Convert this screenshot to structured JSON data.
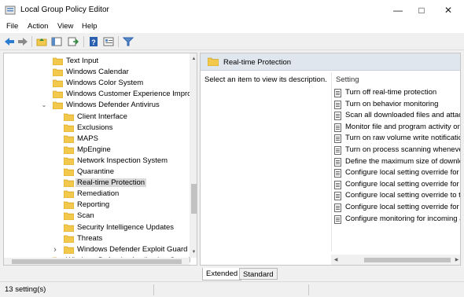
{
  "window": {
    "title": "Local Group Policy Editor"
  },
  "menu": [
    "File",
    "Action",
    "View",
    "Help"
  ],
  "tree": {
    "items": [
      {
        "label": "Text Input",
        "indent": 1,
        "expander": ""
      },
      {
        "label": "Windows Calendar",
        "indent": 1,
        "expander": ""
      },
      {
        "label": "Windows Color System",
        "indent": 1,
        "expander": ""
      },
      {
        "label": "Windows Customer Experience Improv",
        "indent": 1,
        "expander": ""
      },
      {
        "label": "Windows Defender Antivirus",
        "indent": 1,
        "expander": "open"
      },
      {
        "label": "Client Interface",
        "indent": 2,
        "expander": ""
      },
      {
        "label": "Exclusions",
        "indent": 2,
        "expander": ""
      },
      {
        "label": "MAPS",
        "indent": 2,
        "expander": ""
      },
      {
        "label": "MpEngine",
        "indent": 2,
        "expander": ""
      },
      {
        "label": "Network Inspection System",
        "indent": 2,
        "expander": ""
      },
      {
        "label": "Quarantine",
        "indent": 2,
        "expander": ""
      },
      {
        "label": "Real-time Protection",
        "indent": 2,
        "expander": "",
        "selected": true
      },
      {
        "label": "Remediation",
        "indent": 2,
        "expander": ""
      },
      {
        "label": "Reporting",
        "indent": 2,
        "expander": ""
      },
      {
        "label": "Scan",
        "indent": 2,
        "expander": "",
        "highlighted": true
      },
      {
        "label": "Security Intelligence Updates",
        "indent": 2,
        "expander": ""
      },
      {
        "label": "Threats",
        "indent": 2,
        "expander": ""
      },
      {
        "label": "Windows Defender Exploit Guard",
        "indent": 2,
        "expander": "closed"
      },
      {
        "label": "Windows Defender Application Guard",
        "indent": 1,
        "expander": ""
      }
    ]
  },
  "right": {
    "header_title": "Real-time Protection",
    "description": "Select an item to view its description.",
    "column_header": "Setting",
    "settings": [
      "Turn off real-time protection",
      "Turn on behavior monitoring",
      "Scan all downloaded files and attachments",
      "Monitor file and program activity on your computer",
      "Turn on raw volume write notifications",
      "Turn on process scanning whenever real-time protection is enabled",
      "Define the maximum size of downloaded files and attachments to be scanned",
      "Configure local setting override for turn on behavior monitoring",
      "Configure local setting override for scanning all downloaded files and attachments",
      "Configure local setting override to turn on real-time protection",
      "Configure local setting override for monitoring file and program activity",
      "Configure monitoring for incoming and outgoing file and program activity"
    ]
  },
  "tabs": [
    "Extended",
    "Standard"
  ],
  "status": {
    "text": "13 setting(s)"
  },
  "colors": {
    "folder": "#f2c94c",
    "folder_dark": "#d9a520",
    "highlight_border": "#d13438",
    "header_bg": "#dfe6ee",
    "selected_bg": "#d9d9d9"
  }
}
